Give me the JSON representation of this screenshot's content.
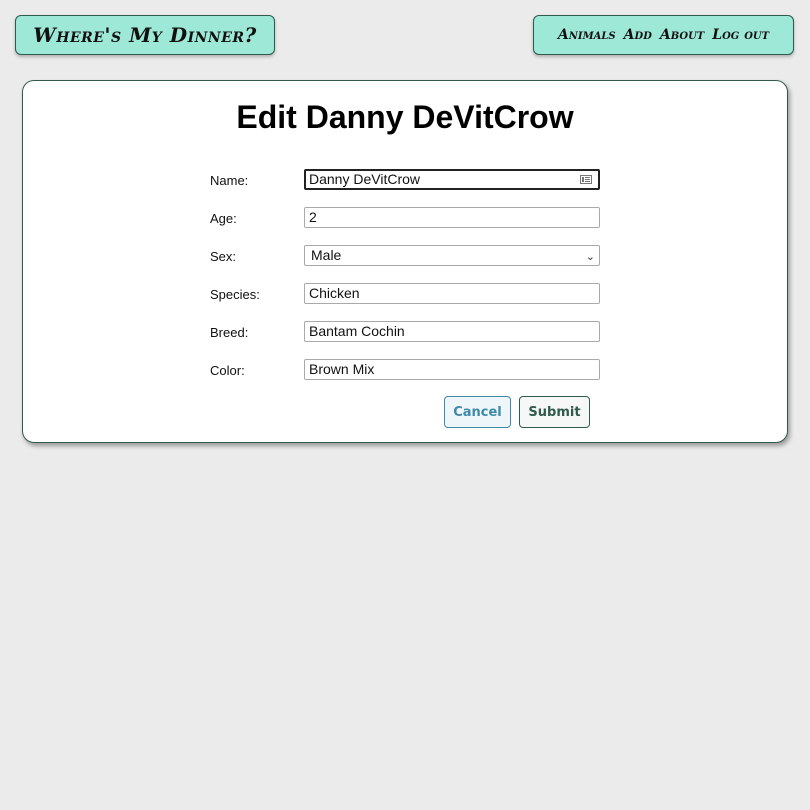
{
  "header": {
    "brand": "Where's My Dinner?",
    "nav": [
      "Animals",
      "Add",
      "About",
      "Log out"
    ]
  },
  "form": {
    "title": "Edit Danny DeVitCrow",
    "fields": [
      {
        "label": "Name:",
        "value": "Danny DeVitCrow"
      },
      {
        "label": "Age:",
        "value": "2"
      },
      {
        "label": "Sex:",
        "value": "Male"
      },
      {
        "label": "Species:",
        "value": "Chicken"
      },
      {
        "label": "Breed:",
        "value": "Bantam Cochin"
      },
      {
        "label": "Color:",
        "value": "Brown Mix"
      }
    ],
    "cancel_label": "Cancel",
    "submit_label": "Submit"
  },
  "colors": {
    "accent": "#9de8d6",
    "border": "#2f5a4c",
    "cancel": "#3d8aa8",
    "background": "#ebebeb"
  }
}
